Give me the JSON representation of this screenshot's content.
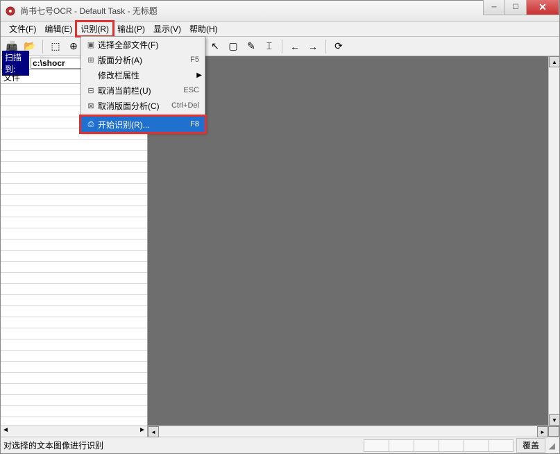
{
  "window": {
    "title": "尚书七号OCR - Default Task - 无标题"
  },
  "menubar": {
    "items": [
      {
        "label": "文件(F)"
      },
      {
        "label": "编辑(E)"
      },
      {
        "label": "识别(R)"
      },
      {
        "label": "输出(P)"
      },
      {
        "label": "显示(V)"
      },
      {
        "label": "帮助(H)"
      }
    ]
  },
  "dropdown": {
    "items": [
      {
        "icon": "select-all-icon",
        "label": "选择全部文件(F)",
        "shortcut": ""
      },
      {
        "icon": "layout-icon",
        "label": "版面分析(A)",
        "shortcut": "F5"
      },
      {
        "icon": "",
        "label": "修改栏属性",
        "shortcut": "",
        "submenu": true
      },
      {
        "icon": "cancel-col-icon",
        "label": "取消当前栏(U)",
        "shortcut": "ESC"
      },
      {
        "icon": "cancel-layout-icon",
        "label": "取消版面分析(C)",
        "shortcut": "Ctrl+Del"
      },
      {
        "icon": "recognize-icon",
        "label": "开始识别(R)...",
        "shortcut": "F8"
      }
    ]
  },
  "sidebar": {
    "scan_label": "扫描到:",
    "scan_value": "c:\\shocr",
    "file_header": "文件"
  },
  "statusbar": {
    "text": "对选择的文本图像进行识别",
    "overwrite_label": "覆盖"
  },
  "icons": {
    "app": "◉",
    "scan": "📠",
    "open": "📂",
    "zoom_area": "⬚",
    "zoom_in": "⊕",
    "zoom_out": "⊖",
    "fit": "▭",
    "rotate": "↻",
    "layout1": "▦",
    "layout2": "▤",
    "layout3": "▥",
    "cursor": "↖",
    "rect": "▢",
    "wand": "✎",
    "text": "⌶",
    "prev": "←",
    "next": "→",
    "refresh": "⟳"
  }
}
